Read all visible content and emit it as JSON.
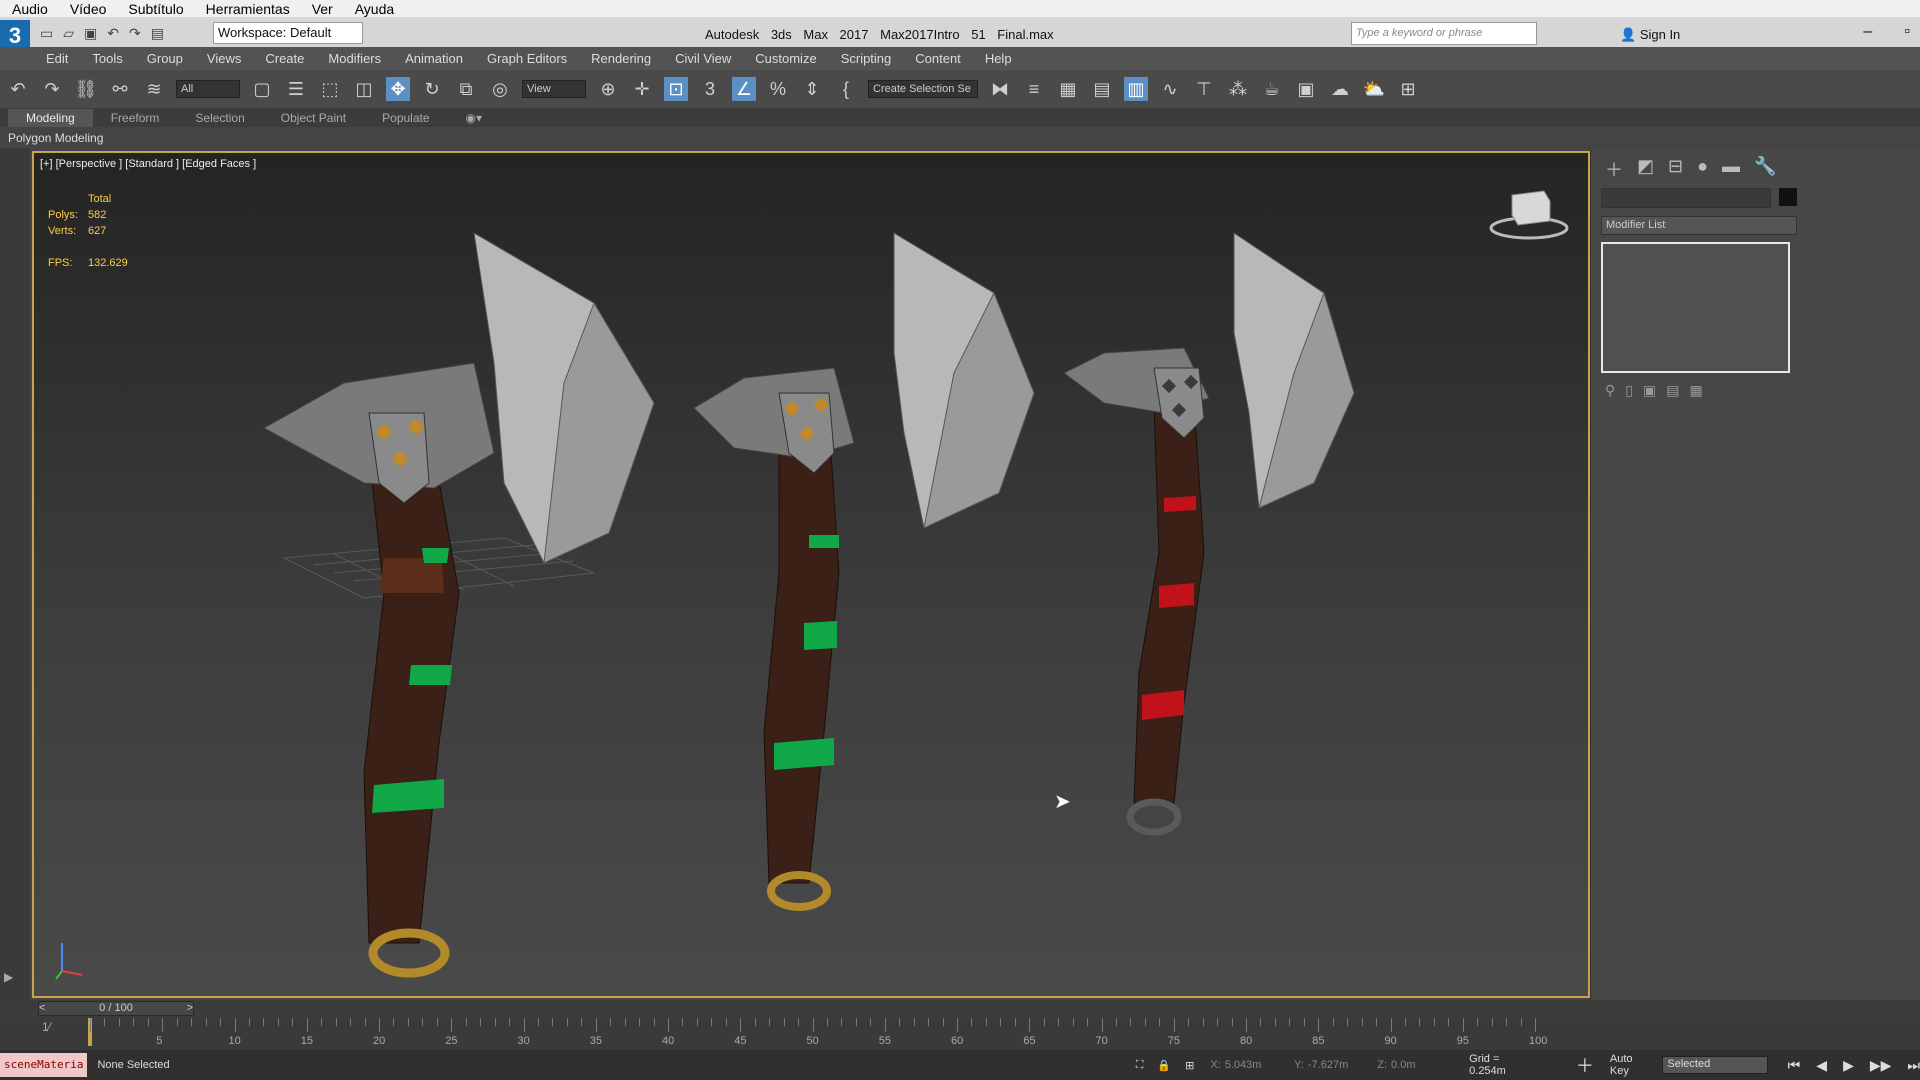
{
  "player_menu": [
    "Audio",
    "Vídeo",
    "Subtítulo",
    "Herramientas",
    "Ver",
    "Ayuda"
  ],
  "titlebar": {
    "logo": "3",
    "workspace": "Workspace: Default",
    "app": "Autodesk 3ds Max 2017",
    "file": "Max2017Intro 51 Final.max",
    "search_placeholder": "Type a keyword or phrase",
    "signin": "Sign In"
  },
  "menubar": [
    "Edit",
    "Tools",
    "Group",
    "Views",
    "Create",
    "Modifiers",
    "Animation",
    "Graph Editors",
    "Rendering",
    "Civil View",
    "Customize",
    "Scripting",
    "Content",
    "Help"
  ],
  "toolbar": {
    "filter_all": "All",
    "view": "View",
    "create_selection": "Create Selection Se",
    "snap3": "3",
    "percent": "%"
  },
  "ribbon": {
    "tabs": [
      "Modeling",
      "Freeform",
      "Selection",
      "Object Paint",
      "Populate"
    ],
    "active": "Modeling",
    "panel": "Polygon Modeling"
  },
  "viewport": {
    "label": "[+] [Perspective ] [Standard ] [Edged Faces ]",
    "stats": {
      "total": "Total",
      "polys_label": "Polys:",
      "polys": "582",
      "verts_label": "Verts:",
      "verts": "627",
      "fps_label": "FPS:",
      "fps": "132.629"
    }
  },
  "command_panel": {
    "modifier_list": "Modifier List"
  },
  "timeline": {
    "frame": "0 / 100",
    "ticks": [
      "5",
      "10",
      "15",
      "20",
      "25",
      "30",
      "35",
      "40",
      "45",
      "50",
      "55",
      "60",
      "65",
      "70",
      "75",
      "80",
      "85",
      "90",
      "95",
      "100"
    ]
  },
  "status": {
    "script": "sceneMateria",
    "selection": "None Selected",
    "x_label": "X:",
    "x": "5.043m",
    "y_label": "Y:",
    "y": "-7.627m",
    "z_label": "Z:",
    "z": "0.0m",
    "grid": "Grid = 0.254m",
    "autokey": "Auto Key",
    "selected": "Selected"
  },
  "colors": {
    "viewport_border": "#c9a34c",
    "stats_text": "#ffcc44",
    "handle_brown": "#3a2016",
    "band_green": "#11a84a",
    "band_red": "#c0121a",
    "blade": "#b8b8b8",
    "ring_gold": "#b28a2a"
  }
}
